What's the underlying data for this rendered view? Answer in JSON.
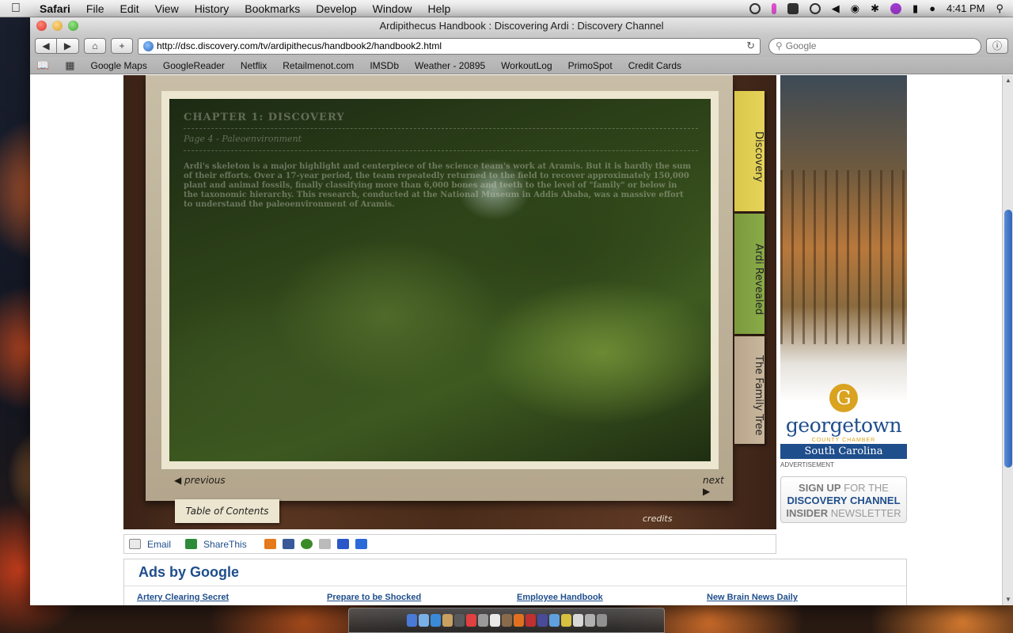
{
  "menubar": {
    "app": "Safari",
    "items": [
      "File",
      "Edit",
      "View",
      "History",
      "Bookmarks",
      "Develop",
      "Window",
      "Help"
    ],
    "clock": "4:41 PM"
  },
  "window": {
    "title": "Ardipithecus Handbook : Discovering Ardi : Discovery Channel",
    "url": "http://dsc.discovery.com/tv/ardipithecus/handbook2/handbook2.html",
    "search_placeholder": "Google"
  },
  "bookmarks": [
    "Google Maps",
    "GoogleReader",
    "Netflix",
    "Retailmenot.com",
    "IMSDb",
    "Weather - 20895",
    "WorkoutLog",
    "PrimoSpot",
    "Credit Cards"
  ],
  "handbook": {
    "chapter_title": "CHAPTER 1: DISCOVERY",
    "page_subtitle": "Page 4 - Paleoenvironment",
    "body": "Ardi's skeleton is a major highlight and centerpiece of the science team's work at Aramis. But it is hardly the sum of their efforts. Over a 17-year period, the team repeatedly returned to the field to recover approximately 150,000 plant and animal fossils, finally classifying more than 6,000 bones and teeth to the level of \"family\" or below in the taxonomic hierarchy. This research, conducted at the National Museum in Addis Ababa, was a massive effort to understand the paleoenvironment of Aramis.",
    "tabs": {
      "discovery": "Discovery",
      "ardi_revealed": "Ardi Revealed",
      "family_tree": "The Family Tree"
    },
    "nav_previous": "previous",
    "nav_next": "next",
    "toc": "Table of Contents",
    "credits": "credits"
  },
  "share": {
    "email": "Email",
    "share_this": "ShareThis"
  },
  "side_ad": {
    "logo_letter": "G",
    "brand": "georgetown",
    "sub": "COUNTY CHAMBER",
    "state": "South Carolina",
    "label": "ADVERTISEMENT"
  },
  "newsletter": {
    "sign_up": "SIGN UP",
    "for_the": " FOR THE",
    "channel": "DISCOVERY CHANNEL",
    "insider": "INSIDER",
    "newsletter": " NEWSLETTER"
  },
  "google_ads": {
    "heading": "Ads by Google",
    "links": [
      "Artery Clearing Secret",
      "Prepare to be Shocked",
      "Employee Handbook",
      "New Brain News Daily"
    ]
  },
  "colors": {
    "link_blue": "#1f4e8c",
    "tab_discovery": "#e6d35a",
    "tab_ardi": "#8aab48",
    "tab_family": "#c9b79d"
  }
}
